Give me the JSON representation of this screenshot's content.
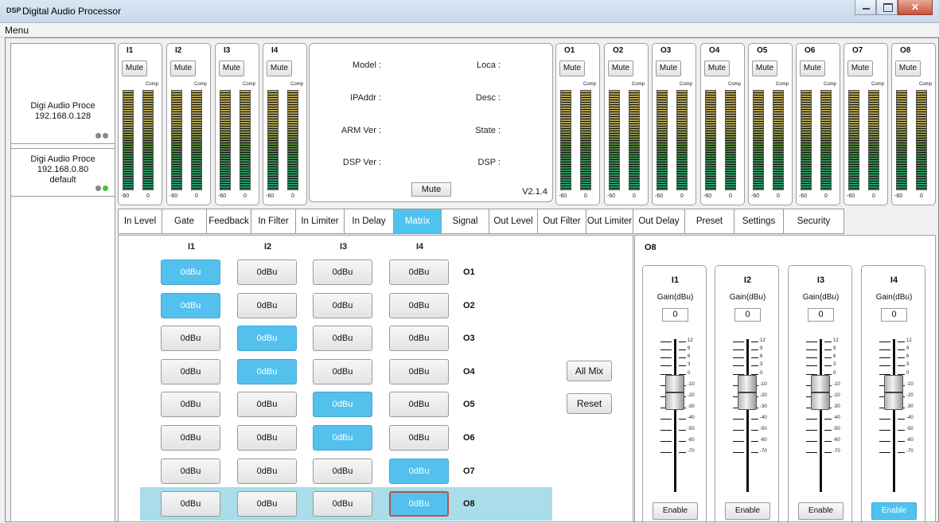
{
  "window": {
    "logo": "DSP",
    "title": "Digital Audio Processor"
  },
  "menu": {
    "label": "Menu"
  },
  "devices": [
    {
      "name": "Digi Audio Proce",
      "ip": "192.168.0.128",
      "note": ""
    },
    {
      "name": "Digi Audio Proce",
      "ip": "192.168.0.80",
      "note": "default"
    }
  ],
  "inputs": [
    {
      "name": "I1",
      "mute": "Mute",
      "comp": "Comp",
      "min": "-60",
      "max": "0"
    },
    {
      "name": "I2",
      "mute": "Mute",
      "comp": "Comp",
      "min": "-60",
      "max": "0"
    },
    {
      "name": "I3",
      "mute": "Mute",
      "comp": "Comp",
      "min": "-60",
      "max": "0"
    },
    {
      "name": "I4",
      "mute": "Mute",
      "comp": "Comp",
      "min": "-60",
      "max": "0"
    }
  ],
  "outputs": [
    {
      "name": "O1",
      "mute": "Mute",
      "comp": "Comp",
      "min": "-60",
      "max": "0"
    },
    {
      "name": "O2",
      "mute": "Mute",
      "comp": "Comp",
      "min": "-60",
      "max": "0"
    },
    {
      "name": "O3",
      "mute": "Mute",
      "comp": "Comp",
      "min": "-60",
      "max": "0"
    },
    {
      "name": "O4",
      "mute": "Mute",
      "comp": "Comp",
      "min": "-60",
      "max": "0"
    },
    {
      "name": "O5",
      "mute": "Mute",
      "comp": "Comp",
      "min": "-60",
      "max": "0"
    },
    {
      "name": "O6",
      "mute": "Mute",
      "comp": "Comp",
      "min": "-60",
      "max": "0"
    },
    {
      "name": "O7",
      "mute": "Mute",
      "comp": "Comp",
      "min": "-60",
      "max": "0"
    },
    {
      "name": "O8",
      "mute": "Mute",
      "comp": "Comp",
      "min": "-60",
      "max": "0"
    }
  ],
  "info": {
    "model": "Model :",
    "loca": "Loca :",
    "ipaddr": "IPAddr :",
    "desc": "Desc :",
    "arm": "ARM Ver :",
    "state": "State :",
    "dspver": "DSP Ver :",
    "dsp": "DSP :",
    "mute": "Mute",
    "version": "V2.1.4"
  },
  "tabs": [
    "In Level",
    "Gate",
    "Feedback",
    "In Filter",
    "In Limiter",
    "In Delay",
    "Matrix",
    "Signal",
    "Out Level",
    "Out Filter",
    "Out Limiter",
    "Out Delay",
    "Preset",
    "Settings",
    "Security"
  ],
  "active_tab": "Matrix",
  "matrix": {
    "columns": [
      "I1",
      "I2",
      "I3",
      "I4"
    ],
    "rows": [
      {
        "label": "O1",
        "cells": [
          "0dBu",
          "0dBu",
          "0dBu",
          "0dBu"
        ]
      },
      {
        "label": "O2",
        "cells": [
          "0dBu",
          "0dBu",
          "0dBu",
          "0dBu"
        ]
      },
      {
        "label": "O3",
        "cells": [
          "0dBu",
          "0dBu",
          "0dBu",
          "0dBu"
        ]
      },
      {
        "label": "O4",
        "cells": [
          "0dBu",
          "0dBu",
          "0dBu",
          "0dBu"
        ]
      },
      {
        "label": "O5",
        "cells": [
          "0dBu",
          "0dBu",
          "0dBu",
          "0dBu"
        ]
      },
      {
        "label": "O6",
        "cells": [
          "0dBu",
          "0dBu",
          "0dBu",
          "0dBu"
        ]
      },
      {
        "label": "O7",
        "cells": [
          "0dBu",
          "0dBu",
          "0dBu",
          "0dBu"
        ]
      },
      {
        "label": "O8",
        "cells": [
          "0dBu",
          "0dBu",
          "0dBu",
          "0dBu"
        ]
      }
    ],
    "active": [
      [
        1,
        0,
        0,
        0
      ],
      [
        1,
        0,
        0,
        0
      ],
      [
        0,
        1,
        0,
        0
      ],
      [
        0,
        1,
        0,
        0
      ],
      [
        0,
        0,
        1,
        0
      ],
      [
        0,
        0,
        1,
        0
      ],
      [
        0,
        0,
        0,
        1
      ],
      [
        0,
        0,
        0,
        1
      ]
    ],
    "selected_row": "O8",
    "all_mix": "All Mix",
    "reset": "Reset"
  },
  "gain_panel": {
    "title": "O8",
    "strips": [
      {
        "name": "I1",
        "label": "Gain(dBu)",
        "value": "0",
        "enable": "Enable",
        "enabled": false
      },
      {
        "name": "I2",
        "label": "Gain(dBu)",
        "value": "0",
        "enable": "Enable",
        "enabled": false
      },
      {
        "name": "I3",
        "label": "Gain(dBu)",
        "value": "0",
        "enable": "Enable",
        "enabled": false
      },
      {
        "name": "I4",
        "label": "Gain(dBu)",
        "value": "0",
        "enable": "Enable",
        "enabled": true
      }
    ],
    "scale": [
      "12",
      "9",
      "6",
      "3",
      "0",
      "-10",
      "-20",
      "-30",
      "-40",
      "-50",
      "-60",
      "-70"
    ]
  },
  "colors": {
    "accent": "#4fc3ef",
    "selected_row": "#a8dde9",
    "selected_border": "#c0504d"
  }
}
